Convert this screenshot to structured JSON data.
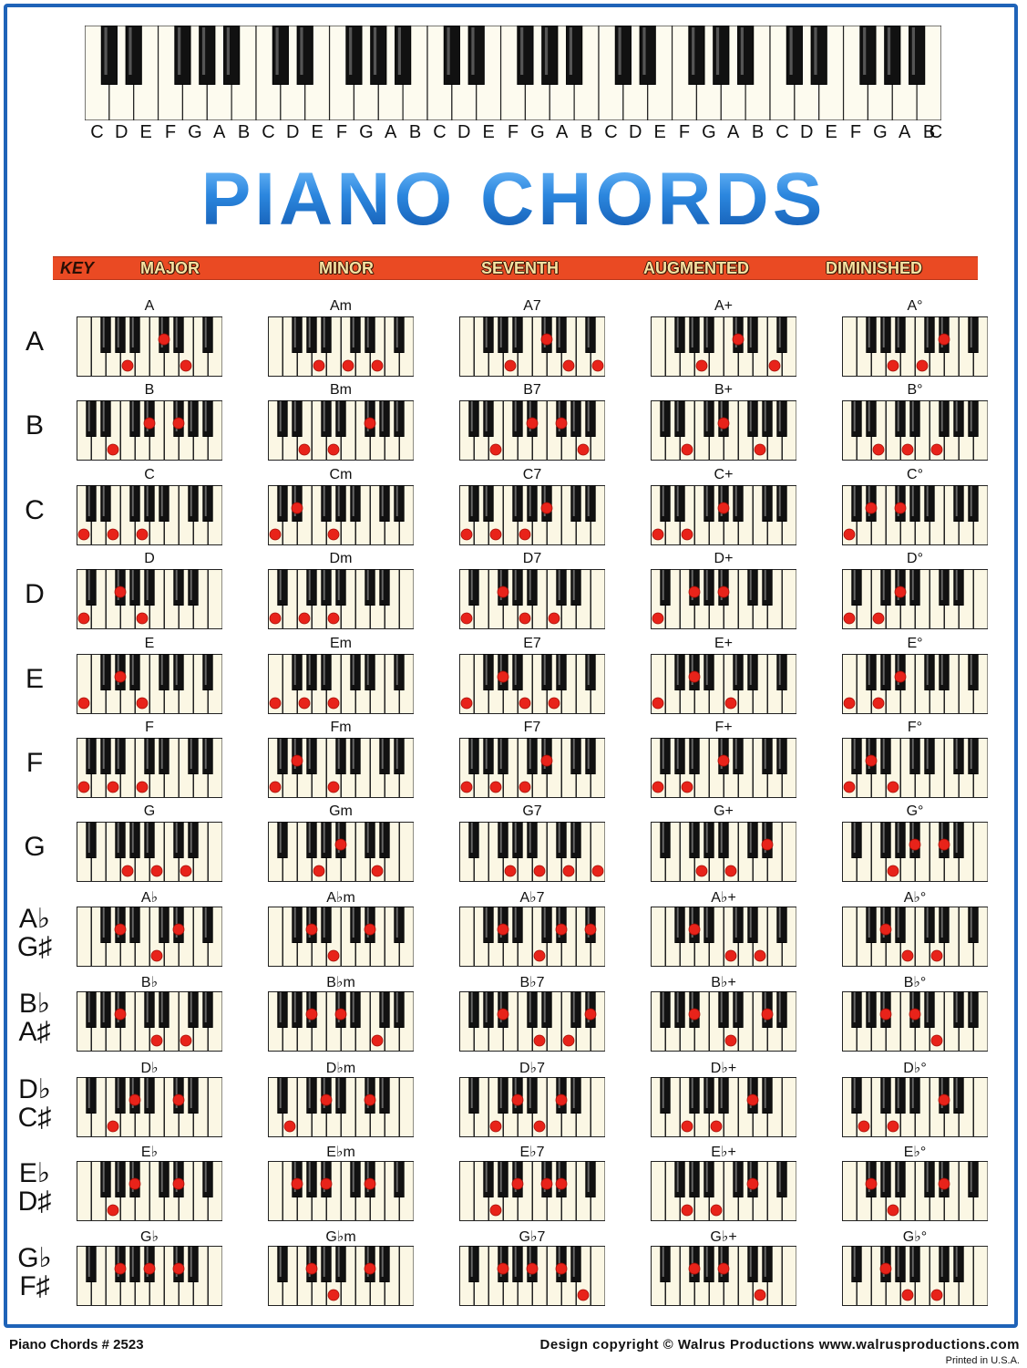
{
  "top_keyboard": {
    "note_letters": [
      "C",
      "D",
      "E",
      "F",
      "G",
      "A",
      "B",
      "C",
      "D",
      "E",
      "F",
      "G",
      "A",
      "B",
      "C",
      "D",
      "E",
      "F",
      "G",
      "A",
      "B",
      "C",
      "D",
      "E",
      "F",
      "G",
      "A",
      "B",
      "C",
      "D",
      "E",
      "F",
      "G",
      "A",
      "B",
      "C"
    ]
  },
  "title": "PIANO CHORDS",
  "header": {
    "key": "KEY",
    "columns": [
      "MAJOR",
      "MINOR",
      "SEVENTH",
      "AUGMENTED",
      "DIMINISHED"
    ]
  },
  "colors": {
    "border": "#1f63b8",
    "bar": "#ea4a23",
    "dot": "#e8231a",
    "title": "#2a7fd6"
  },
  "rows": [
    {
      "key": "A",
      "key2": "",
      "chords": [
        "A",
        "Am",
        "A7",
        "A+",
        "A°"
      ]
    },
    {
      "key": "B",
      "key2": "",
      "chords": [
        "B",
        "Bm",
        "B7",
        "B+",
        "B°"
      ]
    },
    {
      "key": "C",
      "key2": "",
      "chords": [
        "C",
        "Cm",
        "C7",
        "C+",
        "C°"
      ]
    },
    {
      "key": "D",
      "key2": "",
      "chords": [
        "D",
        "Dm",
        "D7",
        "D+",
        "D°"
      ]
    },
    {
      "key": "E",
      "key2": "",
      "chords": [
        "E",
        "Em",
        "E7",
        "E+",
        "E°"
      ]
    },
    {
      "key": "F",
      "key2": "",
      "chords": [
        "F",
        "Fm",
        "F7",
        "F+",
        "F°"
      ]
    },
    {
      "key": "G",
      "key2": "",
      "chords": [
        "G",
        "Gm",
        "G7",
        "G+",
        "G°"
      ]
    },
    {
      "key": "A♭",
      "key2": "G♯",
      "chords": [
        "A♭",
        "A♭m",
        "A♭7",
        "A♭+",
        "A♭°"
      ]
    },
    {
      "key": "B♭",
      "key2": "A♯",
      "chords": [
        "B♭",
        "B♭m",
        "B♭7",
        "B♭+",
        "B♭°"
      ]
    },
    {
      "key": "D♭",
      "key2": "C♯",
      "chords": [
        "D♭",
        "D♭m",
        "D♭7",
        "D♭+",
        "D♭°"
      ]
    },
    {
      "key": "E♭",
      "key2": "D♯",
      "chords": [
        "E♭",
        "E♭m",
        "E♭7",
        "E♭+",
        "E♭°"
      ]
    },
    {
      "key": "G♭",
      "key2": "F♯",
      "chords": [
        "G♭",
        "G♭m",
        "G♭7",
        "G♭+",
        "G♭°"
      ]
    }
  ],
  "footer": {
    "left": "Piano Chords # 2523",
    "right": "Design copyright © Walrus Productions   www.walrusproductions.com",
    "printed": "Printed in U.S.A."
  }
}
